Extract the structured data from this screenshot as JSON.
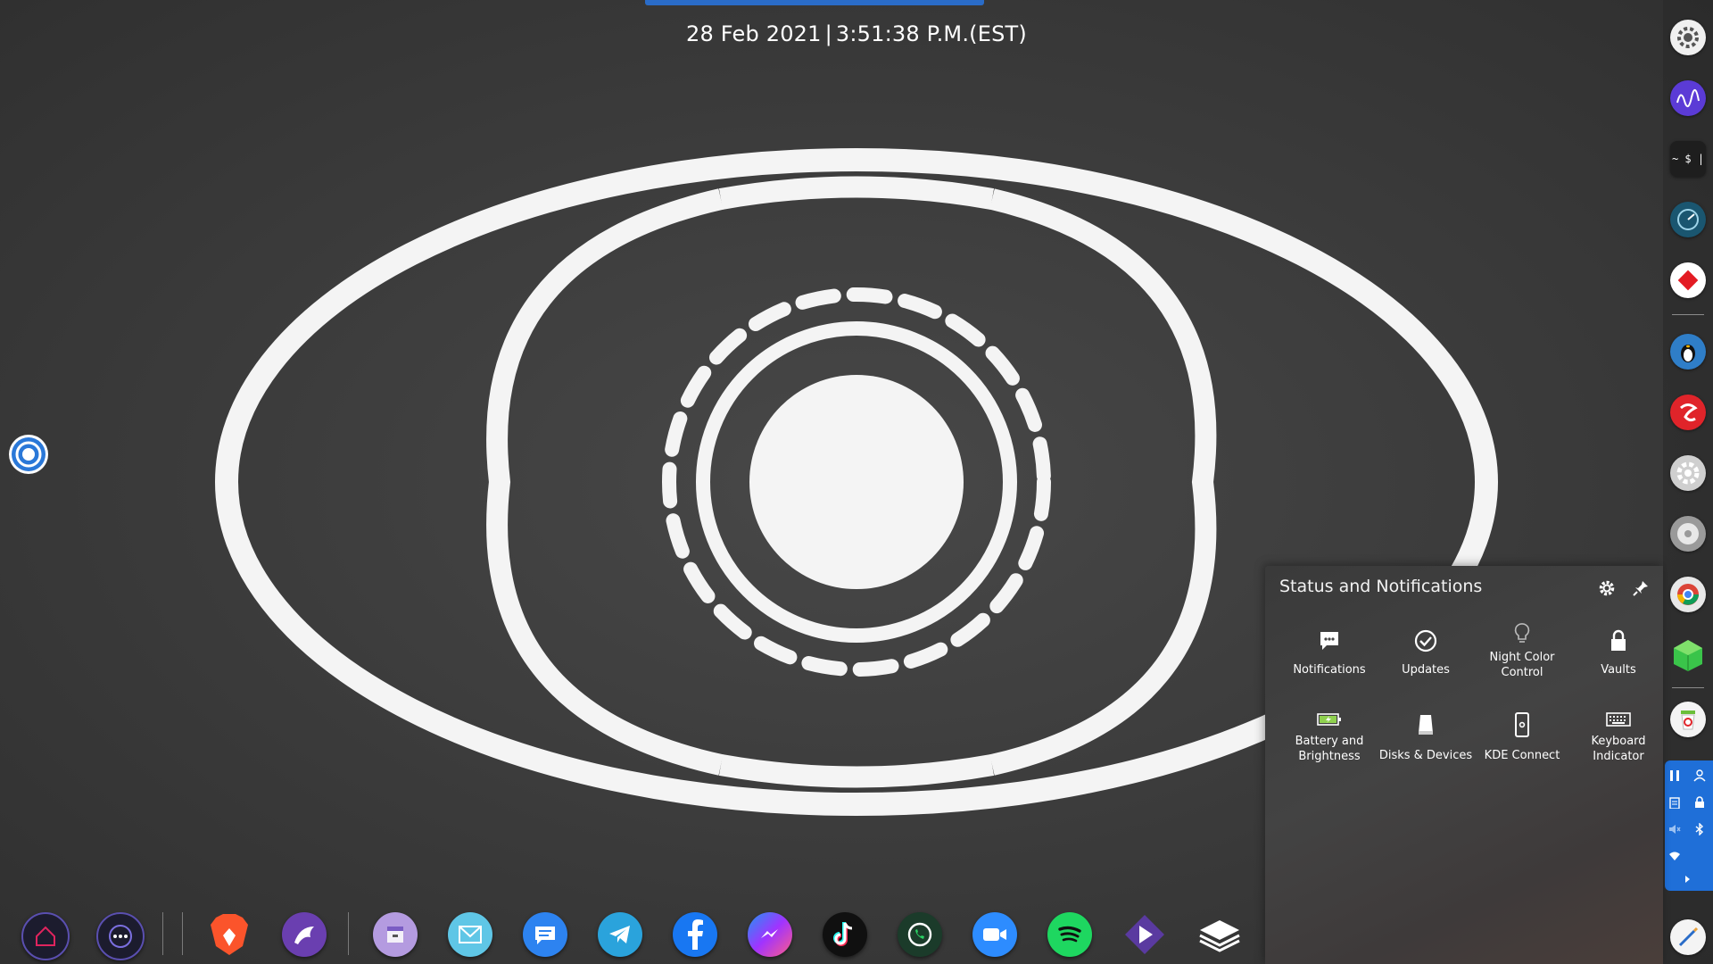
{
  "clock": {
    "date": "28 Feb 2021",
    "separator": "|",
    "time": "3:51:38 P.M.(EST)"
  },
  "status_popup": {
    "title": "Status and Notifications",
    "settings_icon": "gear-icon",
    "pin_icon": "pin-icon",
    "tiles": [
      {
        "label": "Notifications",
        "icon": "chat-bubble-icon"
      },
      {
        "label": "Updates",
        "icon": "check-circle-icon"
      },
      {
        "label": "Night Color\nControl",
        "icon": "light-bulb-icon"
      },
      {
        "label": "Vaults",
        "icon": "lock-icon"
      },
      {
        "label": "Battery and\nBrightness",
        "icon": "battery-icon"
      },
      {
        "label": "Disks & Devices",
        "icon": "disk-icon"
      },
      {
        "label": "KDE Connect",
        "icon": "phone-icon"
      },
      {
        "label": "Keyboard\nIndicator",
        "icon": "keyboard-icon"
      }
    ]
  },
  "right_panel": {
    "icons": [
      "settings-cog-icon",
      "waveform-icon",
      "terminal-icon",
      "speedometer-icon",
      "red-diamond-icon",
      "penguin-icon",
      "red-swirl-icon",
      "system-settings-icon",
      "disc-icon",
      "chrome-icon",
      "green-cube-icon",
      "trash-icon"
    ],
    "terminal_label": "~ $ |",
    "tray": [
      "pause-icon",
      "user-icon",
      "clipboard-icon",
      "lock-icon",
      "volume-muted-icon",
      "bluetooth-icon",
      "wifi-icon",
      "expand-arrow-icon"
    ]
  },
  "dock": {
    "icons": [
      "home-icon",
      "more-apps-icon",
      "brave-browser-icon",
      "eagle-icon",
      "archive-icon",
      "mail-icon",
      "messages-icon",
      "telegram-icon",
      "facebook-icon",
      "messenger-icon",
      "tiktok-icon",
      "whatsapp-icon",
      "zoom-icon",
      "spotify-icon",
      "play-arrow-icon",
      "layers-icon"
    ]
  },
  "colors": {
    "accent_blue": "#1f6fd8",
    "popup_text": "#ffffff",
    "desktop_bg": "#3c3c3c"
  }
}
